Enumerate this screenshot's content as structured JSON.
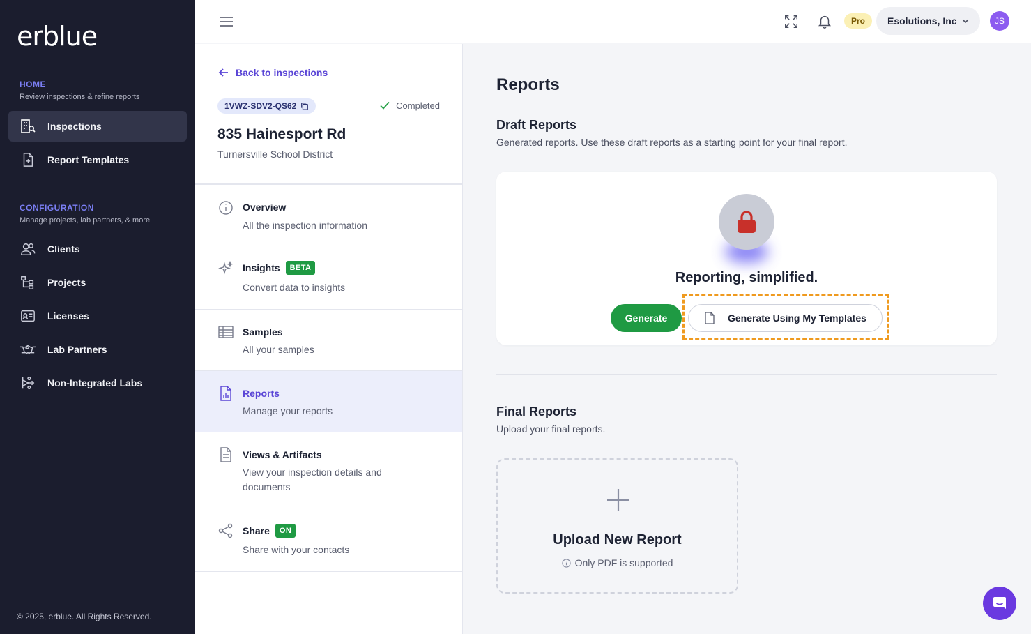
{
  "brand": {
    "logo_text": "erblue"
  },
  "sidebar": {
    "home": {
      "title": "HOME",
      "subtitle": "Review inspections & refine reports"
    },
    "config": {
      "title": "CONFIGURATION",
      "subtitle": "Manage projects, lab partners, & more"
    },
    "items": [
      {
        "label": "Inspections",
        "icon": "building-search-icon",
        "active": true
      },
      {
        "label": "Report Templates",
        "icon": "file-plus-icon"
      },
      {
        "label": "Clients",
        "icon": "users-icon"
      },
      {
        "label": "Projects",
        "icon": "hierarchy-icon"
      },
      {
        "label": "Licenses",
        "icon": "id-card-icon"
      },
      {
        "label": "Lab Partners",
        "icon": "handshake-icon"
      },
      {
        "label": "Non-Integrated Labs",
        "icon": "branch-icon"
      }
    ],
    "copyright": "© 2025, erblue. All Rights Reserved."
  },
  "topbar": {
    "plan_badge": "Pro",
    "org_name": "Esolutions, Inc",
    "avatar_initials": "JS"
  },
  "inspection": {
    "back_label": "Back to inspections",
    "code": "1VWZ-SDV2-QS62",
    "status": "Completed",
    "address": "835 Hainesport Rd",
    "district": "Turnersville School District",
    "menu": [
      {
        "title": "Overview",
        "subtitle": "All the inspection information"
      },
      {
        "title": "Insights",
        "badge": "BETA",
        "subtitle": "Convert data to insights"
      },
      {
        "title": "Samples",
        "subtitle": "All your samples"
      },
      {
        "title": "Reports",
        "subtitle": "Manage your reports",
        "active": true
      },
      {
        "title": "Views & Artifacts",
        "subtitle": "View your inspection details and documents"
      },
      {
        "title": "Share",
        "badge": "ON",
        "subtitle": "Share with your contacts"
      }
    ]
  },
  "reports": {
    "title": "Reports",
    "draft": {
      "heading": "Draft Reports",
      "description": "Generated reports. Use these draft reports as a starting point for your final report.",
      "tagline": "Reporting, simplified.",
      "generate_label": "Generate",
      "templates_label": "Generate Using My Templates"
    },
    "final": {
      "heading": "Final Reports",
      "description": "Upload your final reports.",
      "upload_title": "Upload New Report",
      "upload_note": "Only PDF is supported"
    }
  },
  "colors": {
    "sidebar_bg": "#1b1d2e",
    "accent": "#5a45d6",
    "green": "#1f9a43",
    "highlight": "#ef9a1f"
  }
}
